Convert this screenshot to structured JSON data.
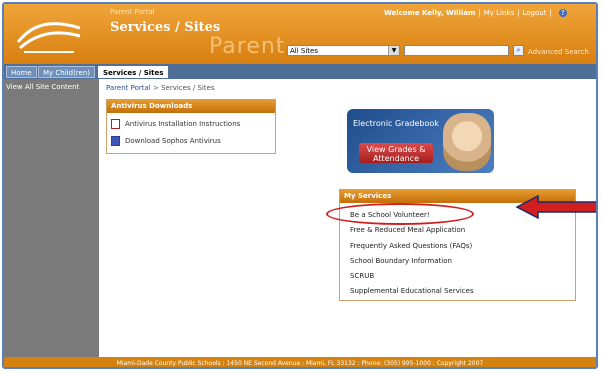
{
  "header": {
    "portal_small": "Parent Portal",
    "title": "Services / Sites",
    "watermark": "Parent",
    "welcome": "Welcome Kelly, William",
    "my_links": "My Links",
    "logout": "Logout",
    "site_select": "All Sites",
    "advanced_search": "Advanced Search"
  },
  "tabs": [
    {
      "label": "Home"
    },
    {
      "label": "My Child(ren)"
    },
    {
      "label": "Services / Sites"
    }
  ],
  "sidebar": {
    "view_all": "View All Site Content"
  },
  "breadcrumb": {
    "root": "Parent Portal",
    "separator": ">",
    "current": "Services / Sites"
  },
  "antivirus": {
    "header": "Antivirus Downloads",
    "items": [
      {
        "label": "Antivirus Installation Instructions"
      },
      {
        "label": "Download Sophos Antivirus"
      }
    ]
  },
  "gradebook": {
    "title": "Electronic Gradebook",
    "button_line1": "View Grades &",
    "button_line2": "Attendance"
  },
  "services": {
    "header": "My Services",
    "items": [
      {
        "label": "Be a School Volunteer!"
      },
      {
        "label": "Free & Reduced Meal Application"
      },
      {
        "label": "Frequently Asked Questions (FAQs)"
      },
      {
        "label": "School Boundary Information"
      },
      {
        "label": "SCRUB"
      },
      {
        "label": "Supplemental Educational Services"
      }
    ]
  },
  "footer": {
    "text": "Miami-Dade County Public Schools : 1450 NE Second Avenue : Miami, FL 33132 : Phone: (305) 995-1000 : Copyright 2007"
  },
  "colors": {
    "header_orange": "#e09428",
    "accent_red": "#d11f1f",
    "nav_blue": "#4f6f98"
  }
}
